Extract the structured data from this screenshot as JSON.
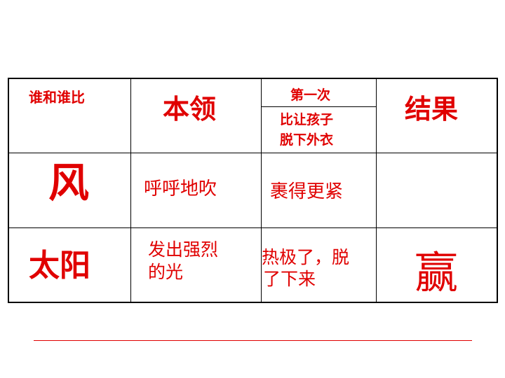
{
  "table": {
    "header": {
      "who": "谁和谁比",
      "skill": "本领",
      "contest_line1": "第一次",
      "contest_line2": "比让孩子",
      "contest_line3": "脱下外衣",
      "result": "结果"
    },
    "rows": [
      {
        "who": "风",
        "skill": "呼呼地吹",
        "contest": "裹得更紧",
        "result": ""
      },
      {
        "who": "太阳",
        "skill_line1": "发出强烈",
        "skill_line2": "的光",
        "contest_line1": "热极了，脱",
        "contest_line2": "了下来",
        "result": "赢"
      }
    ]
  },
  "colors": {
    "text": "#e00000",
    "border": "#000000"
  }
}
